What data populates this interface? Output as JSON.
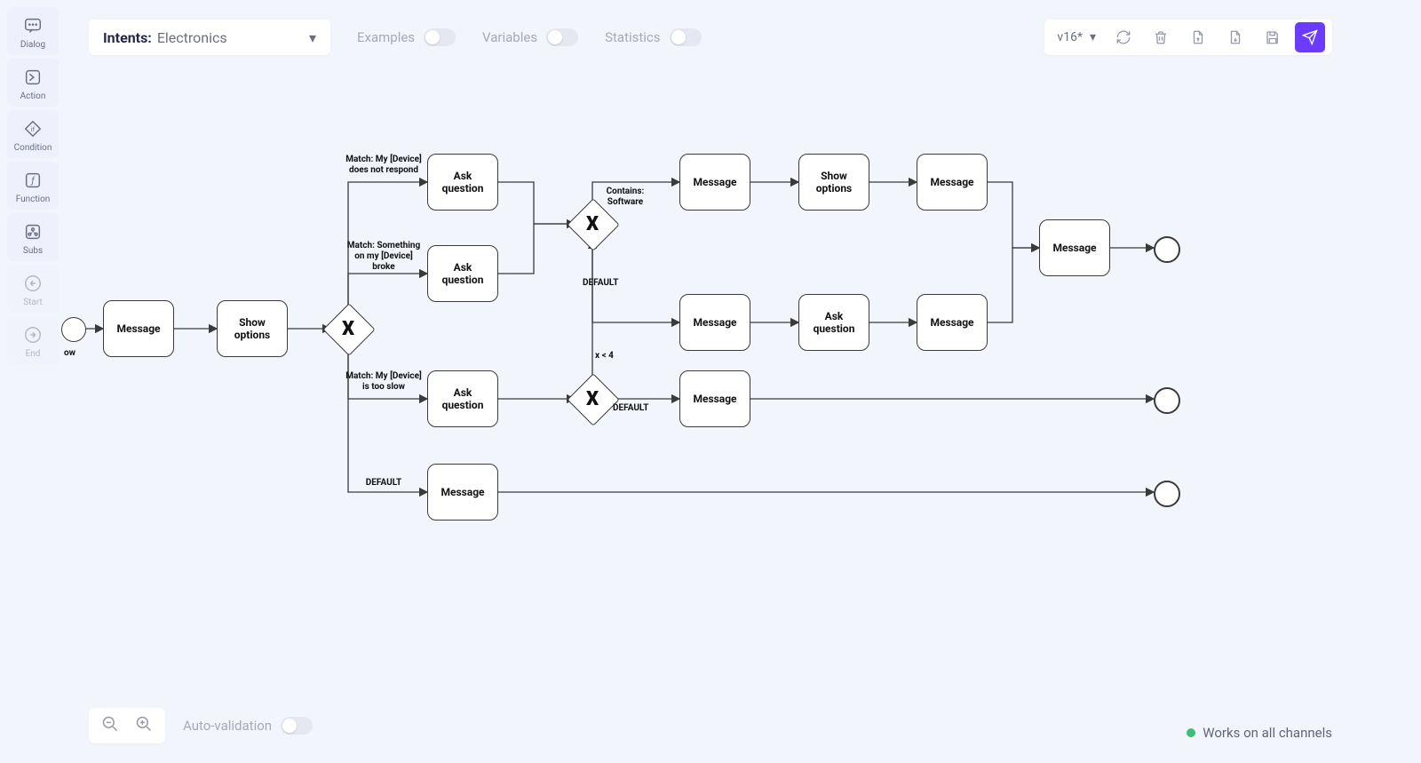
{
  "palette": {
    "dialog": "Dialog",
    "action": "Action",
    "condition": "Condition",
    "function": "Function",
    "subs": "Subs",
    "start": "Start",
    "end": "End"
  },
  "header": {
    "intents_label": "Intents:",
    "intent_value": "Electronics",
    "examples": "Examples",
    "variables": "Variables",
    "statistics": "Statistics"
  },
  "actionbar": {
    "version": "v16*"
  },
  "bottom": {
    "auto_validation": "Auto-validation"
  },
  "status": {
    "text": "Works on all channels"
  },
  "start_event_label": "ow",
  "nodes": {
    "n_msg1": "Message",
    "n_show1": "Show options",
    "n_ask1": "Ask question",
    "n_ask2": "Ask question",
    "n_ask3": "Ask question",
    "n_msg_def": "Message",
    "n_msg_sw": "Message",
    "n_show_sw": "Show options",
    "n_msg_sw2": "Message",
    "n_msg_d1": "Message",
    "n_ask_d1": "Ask question",
    "n_msg_d2": "Message",
    "n_msg_join": "Message",
    "n_msg_slow": "Message"
  },
  "edges": {
    "e_match1": "Match: My [Device] does not respond",
    "e_match2": "Match: Something on my [Device] broke",
    "e_match3": "Match: My [Device] is too slow",
    "e_default1": "DEFAULT",
    "e_contains": "Contains: Software",
    "e_default2": "DEFAULT",
    "e_xlt4": "x < 4",
    "e_default3": "DEFAULT"
  }
}
